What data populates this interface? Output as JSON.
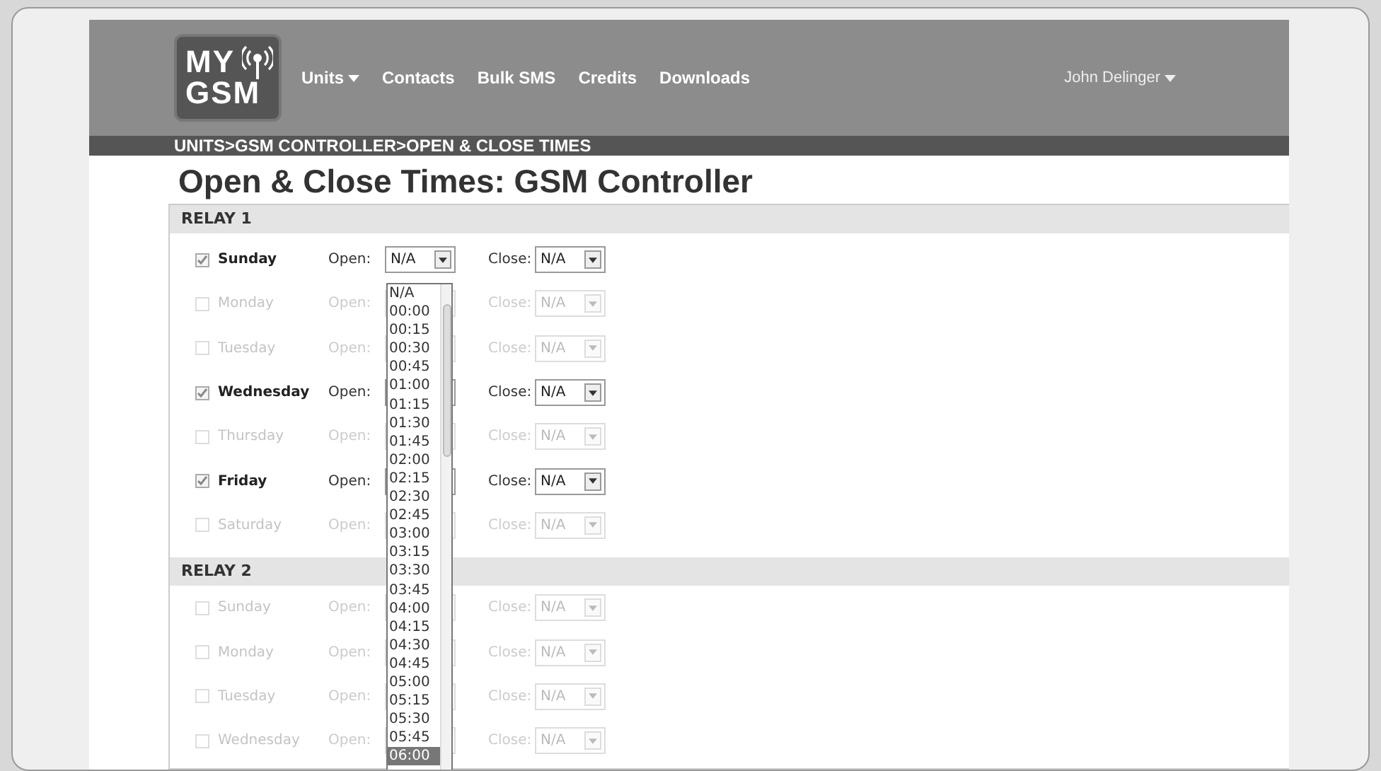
{
  "header": {
    "logo": [
      "MY",
      "GSM"
    ],
    "nav": [
      {
        "label": "Units",
        "dropdown": true
      },
      {
        "label": "Contacts",
        "dropdown": false
      },
      {
        "label": "Bulk SMS",
        "dropdown": false
      },
      {
        "label": "Credits",
        "dropdown": false
      },
      {
        "label": "Downloads",
        "dropdown": false
      }
    ],
    "user": {
      "label": "John Delinger",
      "dropdown": true
    }
  },
  "breadcrumb": "UNITS>GSM CONTROLLER>OPEN & CLOSE TIMES",
  "title": "Open & Close Times: GSM Controller",
  "relays": [
    {
      "title": "RELAY 1",
      "days": [
        {
          "label": "Sunday",
          "checked": true,
          "open_label": "Open:",
          "open_value": "N/A",
          "close_label": "Close:",
          "close_value": "N/A"
        },
        {
          "label": "Monday",
          "checked": false,
          "open_label": "Open:",
          "close_label": "Close:",
          "close_value": "N/A"
        },
        {
          "label": "Tuesday",
          "checked": false,
          "open_label": "Open:",
          "close_label": "Close:",
          "close_value": "N/A"
        },
        {
          "label": "Wednesday",
          "checked": true,
          "open_label": "Open:",
          "close_label": "Close:",
          "close_value": "N/A"
        },
        {
          "label": "Thursday",
          "checked": false,
          "open_label": "Open:",
          "close_label": "Close:",
          "close_value": "N/A"
        },
        {
          "label": "Friday",
          "checked": true,
          "open_label": "Open:",
          "close_label": "Close:",
          "close_value": "N/A"
        },
        {
          "label": "Saturday",
          "checked": false,
          "open_label": "Open:",
          "close_label": "Close:",
          "close_value": "N/A"
        }
      ]
    },
    {
      "title": "RELAY 2",
      "days": [
        {
          "label": "Sunday",
          "checked": false,
          "open_label": "Open:",
          "close_label": "Close:",
          "close_value": "N/A"
        },
        {
          "label": "Monday",
          "checked": false,
          "open_label": "Open:",
          "close_label": "Close:",
          "close_value": "N/A"
        },
        {
          "label": "Tuesday",
          "checked": false,
          "open_label": "Open:",
          "close_label": "Close:",
          "close_value": "N/A"
        },
        {
          "label": "Wednesday",
          "checked": false,
          "open_label": "Open:",
          "close_label": "Close:",
          "close_value": "N/A"
        }
      ]
    }
  ],
  "dropdown_list": {
    "options": [
      {
        "label": "N/A",
        "selected": false
      },
      {
        "label": "00:00",
        "selected": false
      },
      {
        "label": "00:15",
        "selected": false
      },
      {
        "label": "00:30",
        "selected": false
      },
      {
        "label": "00:45",
        "selected": false
      },
      {
        "label": "01:00",
        "selected": false
      },
      {
        "label": "01:15",
        "selected": false
      },
      {
        "label": "01:30",
        "selected": false
      },
      {
        "label": "01:45",
        "selected": false
      },
      {
        "label": "02:00",
        "selected": false
      },
      {
        "label": "02:15",
        "selected": false
      },
      {
        "label": "02:30",
        "selected": false
      },
      {
        "label": "02:45",
        "selected": false
      },
      {
        "label": "03:00",
        "selected": false
      },
      {
        "label": "03:15",
        "selected": false
      },
      {
        "label": "03:30",
        "selected": false
      },
      {
        "label": "03:45",
        "selected": false
      },
      {
        "label": "04:00",
        "selected": false
      },
      {
        "label": "04:15",
        "selected": false
      },
      {
        "label": "04:30",
        "selected": false
      },
      {
        "label": "04:45",
        "selected": false
      },
      {
        "label": "05:00",
        "selected": false
      },
      {
        "label": "05:15",
        "selected": false
      },
      {
        "label": "05:30",
        "selected": false
      },
      {
        "label": "05:45",
        "selected": false
      },
      {
        "label": "06:00",
        "selected": true
      }
    ]
  }
}
